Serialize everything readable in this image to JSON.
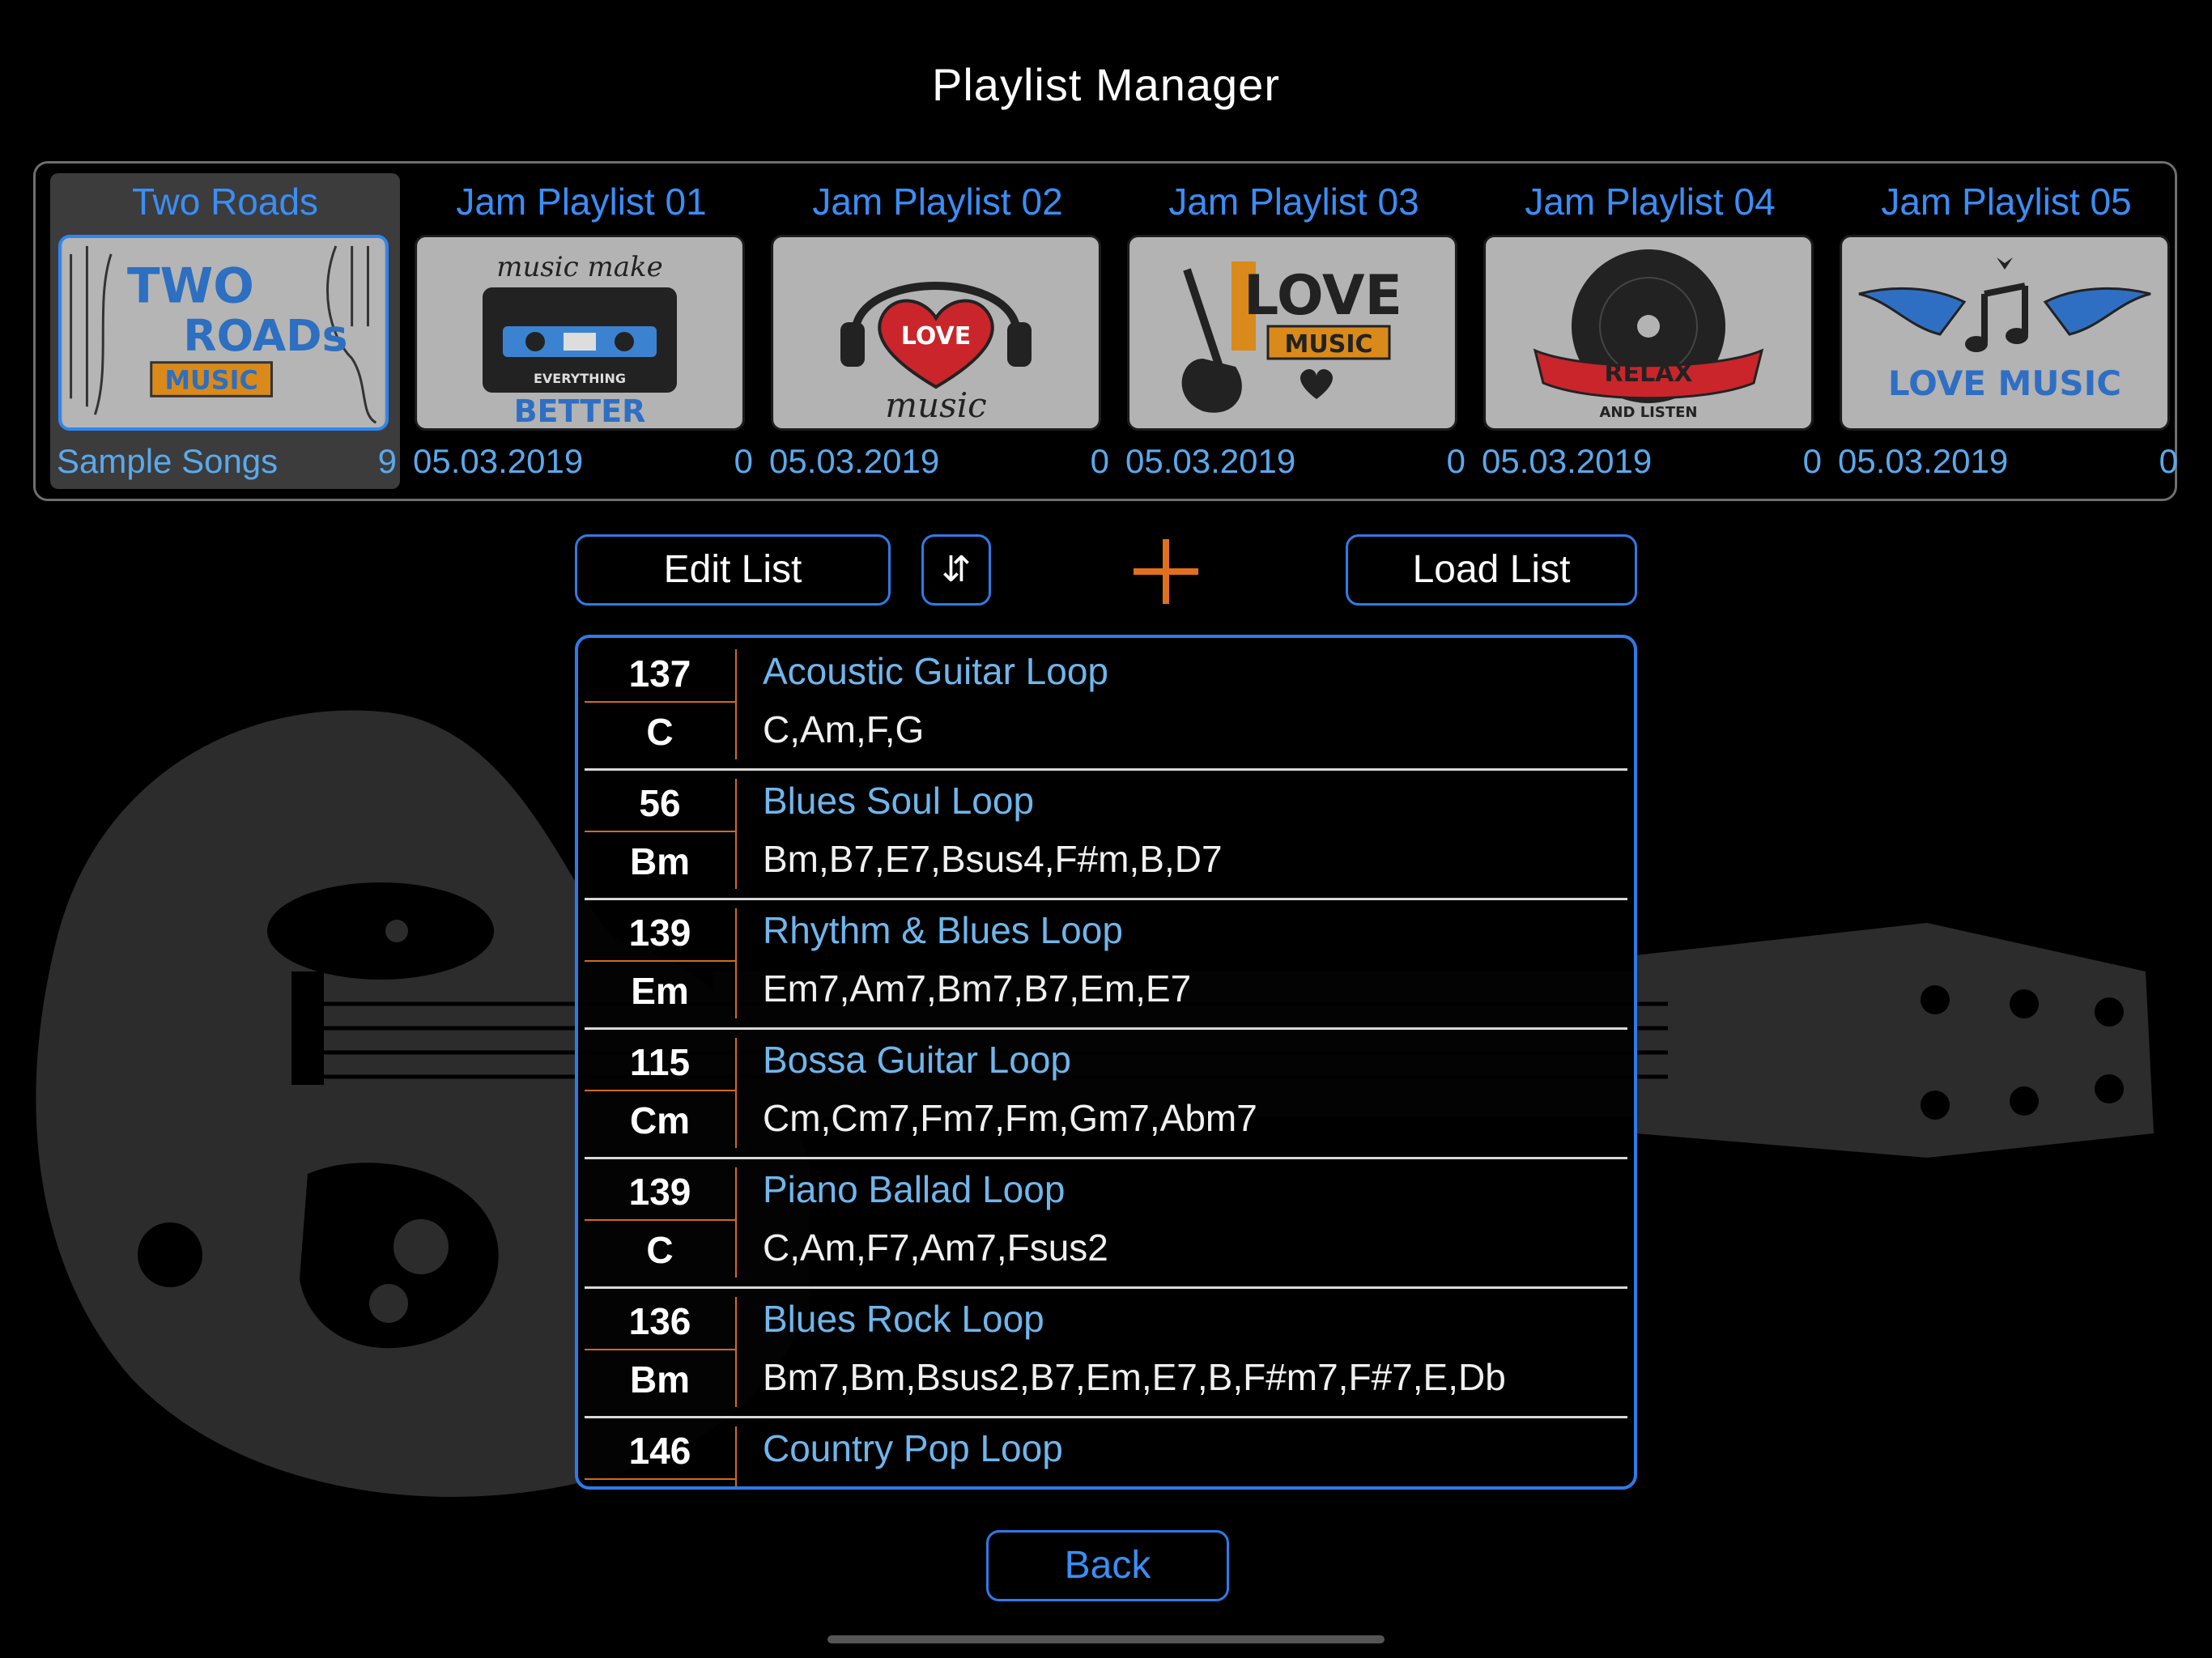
{
  "header": {
    "title": "Playlist Manager"
  },
  "playlists": [
    {
      "name": "Two Roads",
      "subtitle": "Sample Songs",
      "count": "9",
      "selected": true,
      "artwork": "two-roads-music-icon"
    },
    {
      "name": "Jam Playlist 01",
      "subtitle": "05.03.2019",
      "count": "0",
      "selected": false,
      "artwork": "cassette-music-make-everything-better-icon"
    },
    {
      "name": "Jam Playlist 02",
      "subtitle": "05.03.2019",
      "count": "0",
      "selected": false,
      "artwork": "heart-headphones-love-music-icon"
    },
    {
      "name": "Jam Playlist 03",
      "subtitle": "05.03.2019",
      "count": "0",
      "selected": false,
      "artwork": "guitar-love-music-icon"
    },
    {
      "name": "Jam Playlist 04",
      "subtitle": "05.03.2019",
      "count": "0",
      "selected": false,
      "artwork": "vinyl-relax-and-listen-icon"
    },
    {
      "name": "Jam Playlist 05",
      "subtitle": "05.03.2019",
      "count": "0",
      "selected": false,
      "artwork": "winged-notes-love-music-icon"
    }
  ],
  "artwork_text": {
    "two_roads": {
      "line1": "TWO",
      "line2": "ROADs",
      "badge": "MUSIC"
    },
    "cassette": {
      "top": "music make",
      "middle": "EVERYTHING",
      "bottom": "BETTER"
    },
    "heart": {
      "center": "LOVE",
      "script": "music"
    },
    "guitar": {
      "big": "LOVE",
      "badge": "MUSIC"
    },
    "vinyl": {
      "ribbon": "RELAX",
      "bottom": "AND LISTEN"
    },
    "wings": {
      "text": "LOVE MUSIC"
    }
  },
  "toolbar": {
    "edit_label": "Edit List",
    "sort_label": "⇵",
    "add_icon": "plus-icon",
    "load_label": "Load List"
  },
  "songs": [
    {
      "bpm": "137",
      "key": "C",
      "title": "Acoustic Guitar Loop",
      "chords": "C,Am,F,G"
    },
    {
      "bpm": "56",
      "key": "Bm",
      "title": "Blues Soul Loop",
      "chords": "Bm,B7,E7,Bsus4,F#m,B,D7"
    },
    {
      "bpm": "139",
      "key": "Em",
      "title": "Rhythm & Blues Loop",
      "chords": "Em7,Am7,Bm7,B7,Em,E7"
    },
    {
      "bpm": "115",
      "key": "Cm",
      "title": "Bossa Guitar Loop",
      "chords": "Cm,Cm7,Fm7,Fm,Gm7,Abm7"
    },
    {
      "bpm": "139",
      "key": "C",
      "title": "Piano Ballad Loop",
      "chords": "C,Am,F7,Am7,Fsus2"
    },
    {
      "bpm": "136",
      "key": "Bm",
      "title": "Blues Rock Loop",
      "chords": "Bm7,Bm,Bsus2,B7,Em,E7,B,F#m7,F#7,E,Db"
    },
    {
      "bpm": "146",
      "key": "",
      "title": "Country Pop Loop",
      "chords": ""
    }
  ],
  "footer": {
    "back_label": "Back"
  },
  "colors": {
    "accent_blue": "#2f7ae8",
    "title_blue": "#3a8ef6",
    "song_title_blue": "#6fb6ec",
    "divider_orange": "#d2691e",
    "plus_orange": "#e0701e",
    "background": "#000000"
  }
}
